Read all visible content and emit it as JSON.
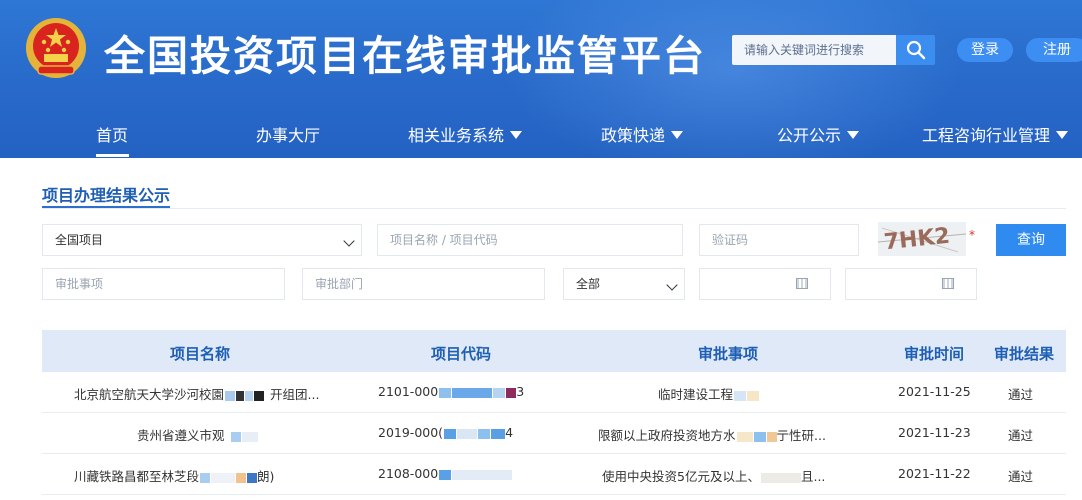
{
  "header": {
    "title": "全国投资项目在线审批监管平台",
    "search_placeholder": "请输入关键词进行搜索",
    "login": "登录",
    "register": "注册",
    "brand_colors": {
      "primary": "#2869c9",
      "accent": "#3d8ef2"
    }
  },
  "nav": {
    "items": [
      {
        "label": "首页",
        "active": true,
        "dropdown": false
      },
      {
        "label": "办事大厅",
        "dropdown": false
      },
      {
        "label": "相关业务系统",
        "dropdown": true
      },
      {
        "label": "政策快递",
        "dropdown": true
      },
      {
        "label": "公开公示",
        "dropdown": true
      },
      {
        "label": "工程咨询行业管理",
        "dropdown": true
      }
    ]
  },
  "section": {
    "title": "项目办理结果公示"
  },
  "form": {
    "project_scope": "全国项目",
    "project_name_placeholder": "项目名称 / 项目代码",
    "captcha_placeholder": "验证码",
    "captcha_text": "7HK2",
    "required_mark": "*",
    "query_button": "查询",
    "approval_item_placeholder": "审批事项",
    "approval_dept_placeholder": "审批部门",
    "status_select": "全部"
  },
  "table": {
    "headers": [
      "项目名称",
      "项目代码",
      "审批事项",
      "审批时间",
      "审批结果"
    ],
    "rows": [
      {
        "name": "北京航空航天大学沙河校園",
        "name_tail": "开组团...",
        "code": "2101-000",
        "code_tail": "3",
        "item": "临时建设工程",
        "date": "2021-11-25",
        "result": "通过"
      },
      {
        "name": "贵州省遵义市观",
        "name_tail": "",
        "code": "2019-000(",
        "code_tail": "4",
        "item": "限额以上政府投资地方水",
        "item_tail": "亍性研...",
        "date": "2021-11-23",
        "result": "通过"
      },
      {
        "name": "川藏铁路昌都至林芝段",
        "name_tail": "朗)",
        "code": "2108-000",
        "code_tail": "",
        "item": "使用中央投资5亿元及以上、",
        "item_tail": "且...",
        "date": "2021-11-22",
        "result": "通过"
      }
    ]
  }
}
